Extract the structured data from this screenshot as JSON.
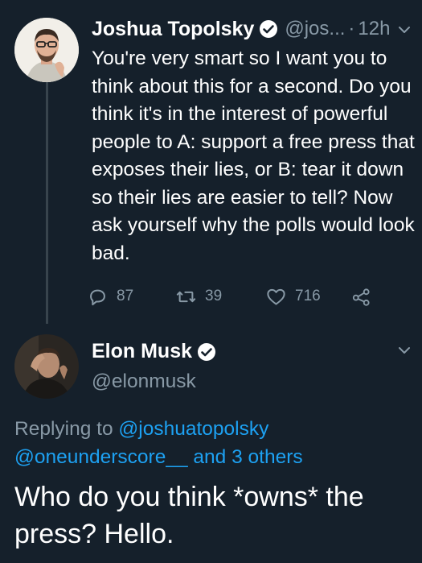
{
  "tweet1": {
    "author_name": "Joshua Topolsky",
    "handle": "@jos...",
    "separator": "·",
    "time": "12h",
    "text": "You're very smart so I want you to think about this for a second. Do you think it's in the interest of powerful people to A: support a free press that exposes their lies, or B: tear it down so their lies are easier to tell? Now ask yourself why the polls would look bad.",
    "replies": "87",
    "retweets": "39",
    "likes": "716"
  },
  "tweet2": {
    "author_name": "Elon Musk",
    "handle": "@elonmusk",
    "replying_prefix": "Replying to",
    "reply_to_1": "@joshuatopolsky",
    "reply_to_2": "@oneunderscore__",
    "reply_others": "and 3 others",
    "text": "Who do you think *owns* the press? Hello."
  },
  "icons": {
    "verified": "verified-badge-icon",
    "chevron": "chevron-down-icon",
    "reply": "reply-icon",
    "retweet": "retweet-icon",
    "like": "heart-icon",
    "share": "share-icon"
  },
  "colors": {
    "background": "#15202b",
    "secondary_text": "#8899a6",
    "link": "#1da1f2",
    "thread_line": "#38444d"
  }
}
